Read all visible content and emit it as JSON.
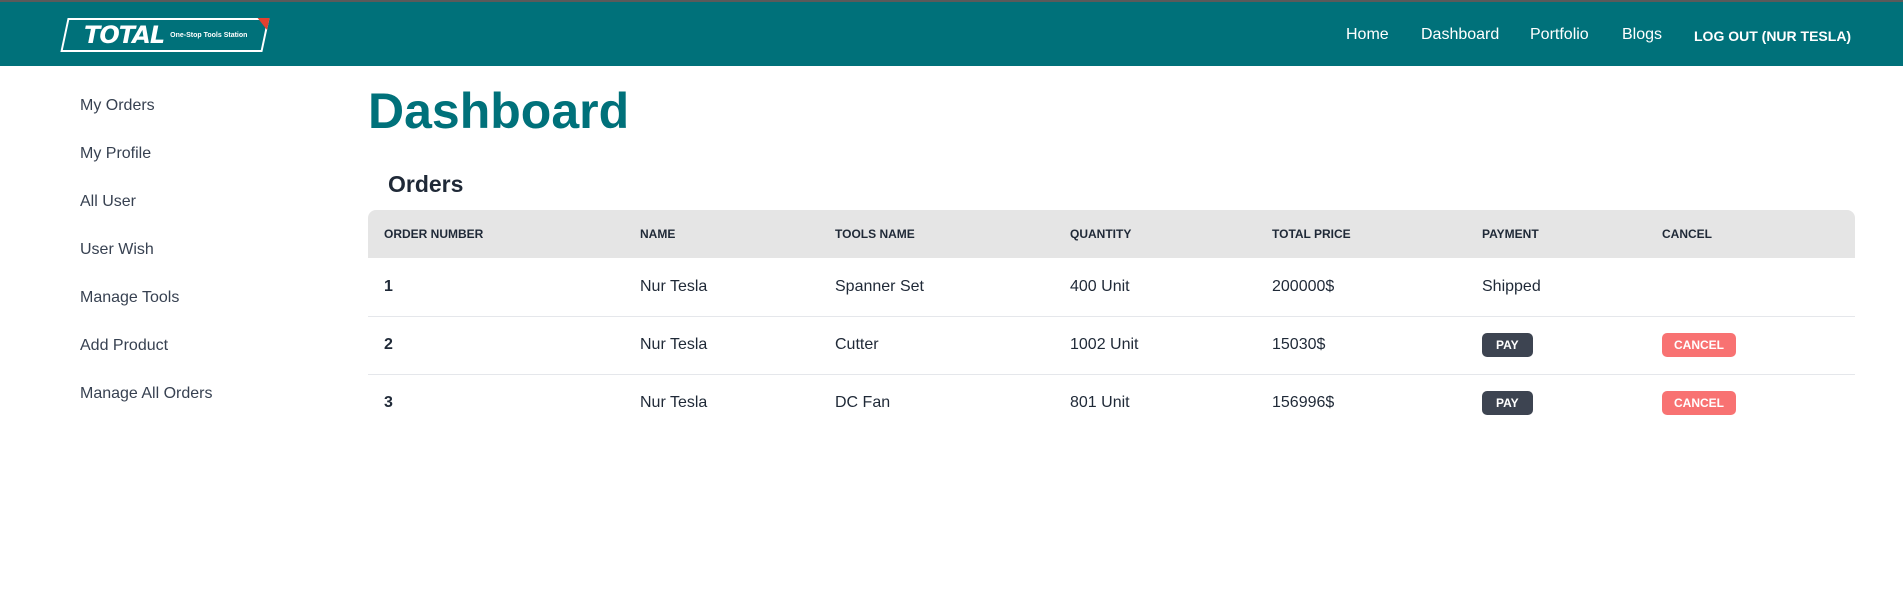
{
  "brand": {
    "logo_text": "TOTAL",
    "tagline": "One-Stop Tools Station"
  },
  "nav": {
    "home": "Home",
    "dashboard": "Dashboard",
    "portfolio": "Portfolio",
    "blogs": "Blogs",
    "logout": "LOG OUT (NUR TESLA)"
  },
  "sidebar": {
    "items": [
      {
        "label": "My Orders"
      },
      {
        "label": "My Profile"
      },
      {
        "label": "All User"
      },
      {
        "label": "User Wish"
      },
      {
        "label": "Manage Tools"
      },
      {
        "label": "Add Product"
      },
      {
        "label": "Manage All Orders"
      }
    ]
  },
  "main": {
    "title": "Dashboard",
    "section_title": "Orders"
  },
  "table": {
    "headers": {
      "order_number": "ORDER NUMBER",
      "name": "NAME",
      "tools_name": "TOOLS NAME",
      "quantity": "QUANTITY",
      "total_price": "TOTAL PRICE",
      "payment": "PAYMENT",
      "cancel": "CANCEL"
    },
    "rows": [
      {
        "order_number": "1",
        "name": "Nur Tesla",
        "tools_name": "Spanner Set",
        "quantity": "400 Unit",
        "total_price": "200000$",
        "payment_status": "Shipped"
      },
      {
        "order_number": "2",
        "name": "Nur Tesla",
        "tools_name": "Cutter",
        "quantity": "1002 Unit",
        "total_price": "15030$",
        "pay_label": "PAY",
        "cancel_label": "CANCEL"
      },
      {
        "order_number": "3",
        "name": "Nur Tesla",
        "tools_name": "DC Fan",
        "quantity": "801 Unit",
        "total_price": "156996$",
        "pay_label": "PAY",
        "cancel_label": "CANCEL"
      }
    ]
  },
  "colors": {
    "primary": "#00717a",
    "pay_button": "#3d4451",
    "cancel_button": "#f87272",
    "table_header": "#e5e5e5"
  }
}
